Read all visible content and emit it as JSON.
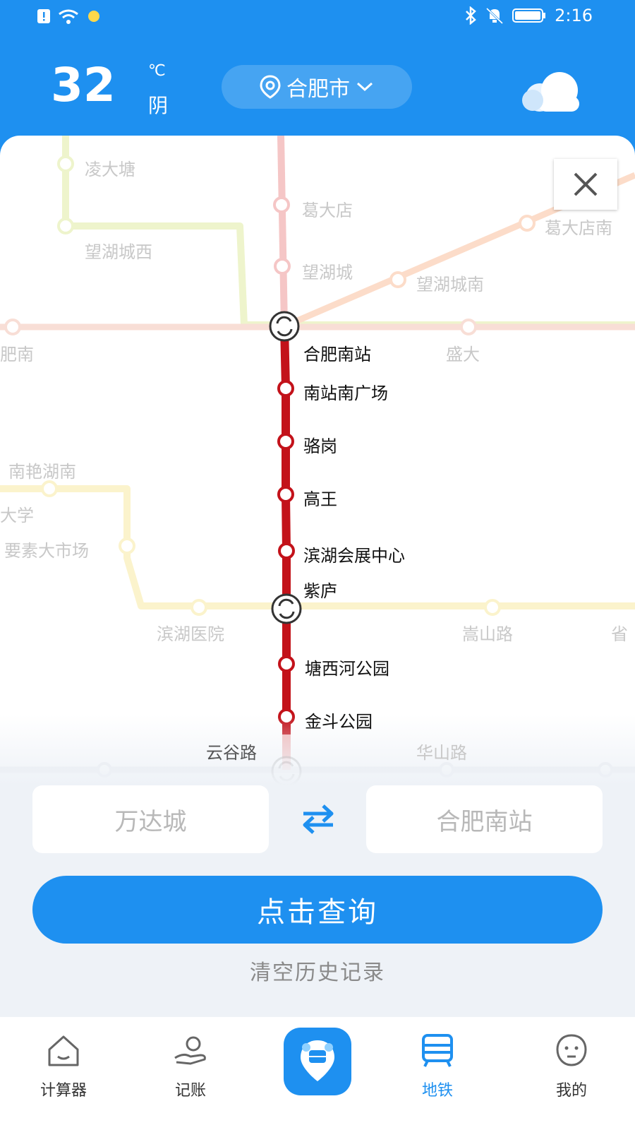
{
  "status_bar": {
    "time": "2:16"
  },
  "weather": {
    "temperature": "32",
    "unit": "℃",
    "condition": "阴",
    "city": "合肥市"
  },
  "map": {
    "active_line_stations": [
      "合肥南站",
      "南站南广场",
      "骆岗",
      "高王",
      "滨湖会展中心",
      "紫庐",
      "塘西河公园",
      "金斗公园",
      "云谷路"
    ],
    "other_stations": [
      "凌大塘",
      "望湖城西",
      "葛大店",
      "望湖城",
      "葛大店南",
      "望湖城南",
      "肥南",
      "盛大",
      "南艳湖南",
      "大学",
      "要素大市场",
      "滨湖医院",
      "嵩山路",
      "省",
      "华山路"
    ]
  },
  "route": {
    "from": "万达城",
    "to": "合肥南站"
  },
  "query_button": "点击查询",
  "clear_history": "清空历史记录",
  "nav": {
    "items": [
      {
        "label": "计算器"
      },
      {
        "label": "记账"
      },
      {
        "label": ""
      },
      {
        "label": "地铁"
      },
      {
        "label": "我的"
      }
    ]
  },
  "colors": {
    "primary": "#1e90f0",
    "metro_line": "#c3121a",
    "background": "#eef2f7"
  }
}
